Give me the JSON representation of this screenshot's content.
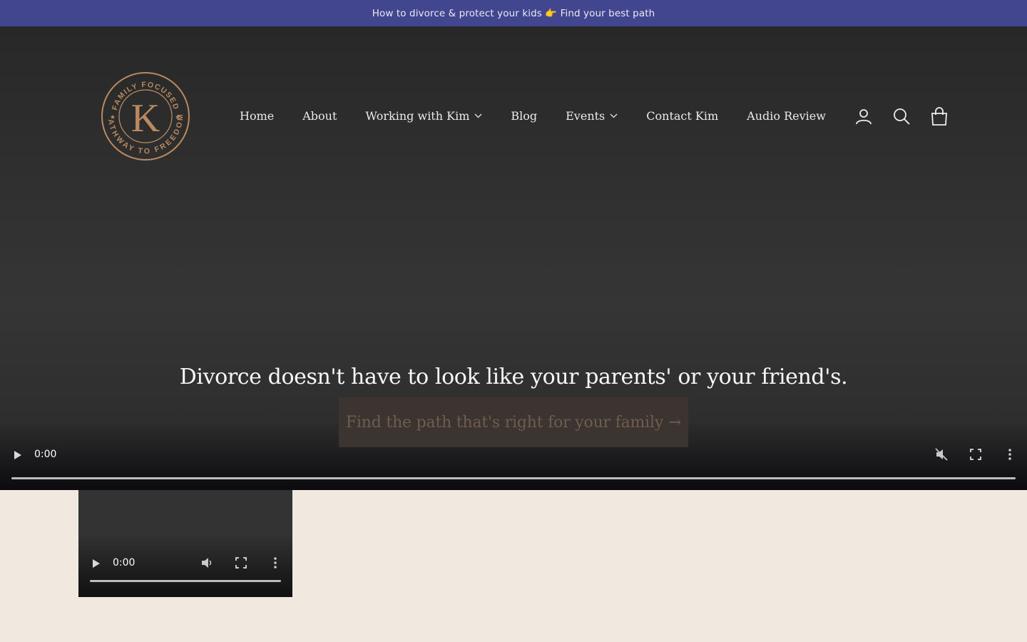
{
  "announcement": {
    "text": "How to divorce & protect your kids 👉 Find your best path"
  },
  "logo": {
    "top_text": "FAMILY FOCUSED",
    "bottom_text": "PATHWAY TO FREEDOM",
    "letter": "K",
    "color": "#b98a5f"
  },
  "nav": {
    "items": [
      {
        "label": "Home",
        "dropdown": false
      },
      {
        "label": "About",
        "dropdown": false
      },
      {
        "label": "Working with Kim",
        "dropdown": true
      },
      {
        "label": "Blog",
        "dropdown": false
      },
      {
        "label": "Events",
        "dropdown": true
      },
      {
        "label": "Contact Kim",
        "dropdown": false
      },
      {
        "label": "Audio Review",
        "dropdown": false
      }
    ]
  },
  "header_icons": [
    "account-icon",
    "search-icon",
    "cart-icon"
  ],
  "hero": {
    "headline": "Divorce doesn't have to look like your parents' or your friend's.",
    "cta_label": "Find the path that's right for your family →"
  },
  "main_video": {
    "time": "0:00",
    "muted": true
  },
  "mini_video": {
    "time": "0:00",
    "muted": false
  },
  "colors": {
    "announcement_bg": "#41468f",
    "page_bg": "#f1e8df",
    "logo_gold": "#b98a5f",
    "cta_bg": "#3b3430"
  }
}
